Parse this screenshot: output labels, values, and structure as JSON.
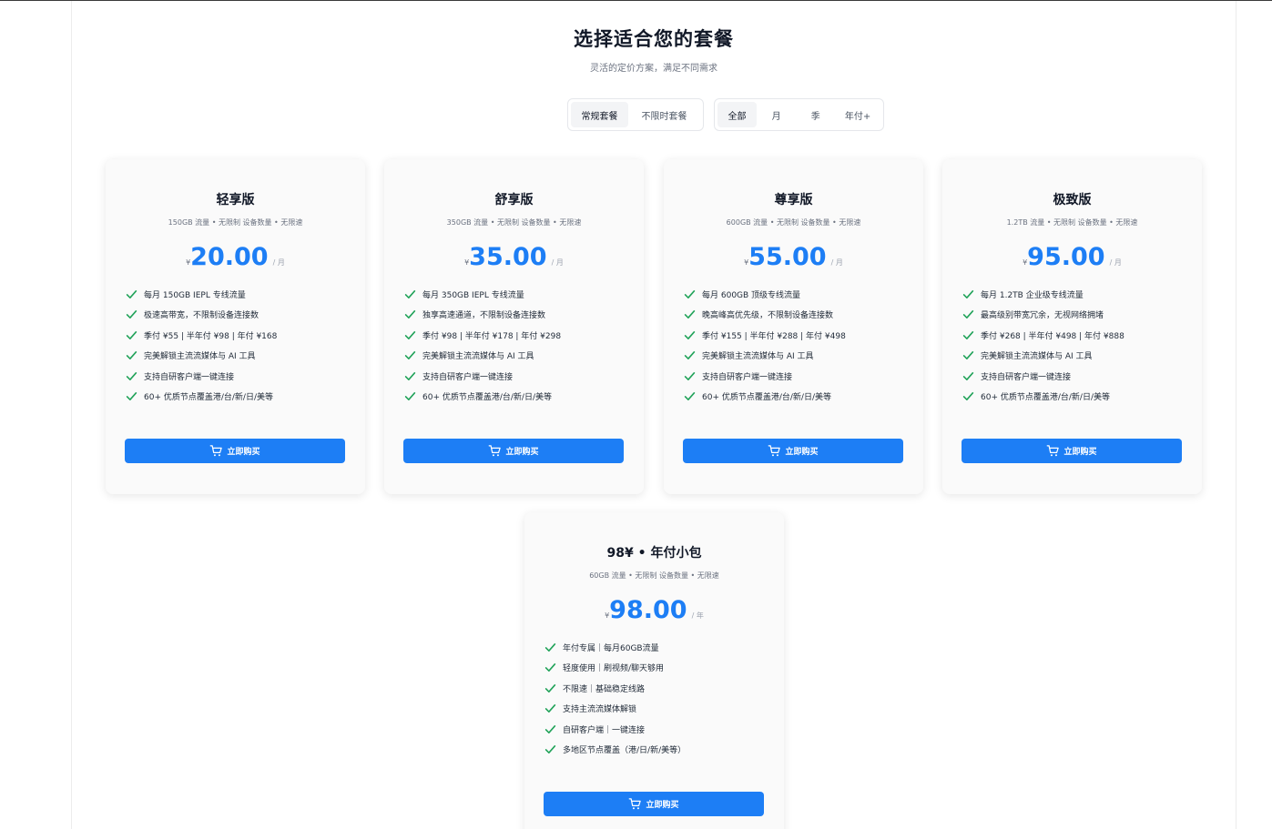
{
  "header": {
    "title": "选择适合您的套餐",
    "subtitle": "灵活的定价方案，满足不同需求"
  },
  "plan_type_tabs": [
    {
      "label": "常规套餐",
      "active": true
    },
    {
      "label": "不限时套餐",
      "active": false
    }
  ],
  "period_tabs": [
    {
      "label": "全部",
      "active": true
    },
    {
      "label": "月",
      "active": false
    },
    {
      "label": "季",
      "active": false
    },
    {
      "label": "年付+",
      "active": false
    }
  ],
  "colors": {
    "accent": "#1d7ef5",
    "check": "#22a35a"
  },
  "plans": [
    {
      "name": "轻享版",
      "tagline": "150GB 流量 • 无限制 设备数量 • 无限速",
      "currency": "¥",
      "price": "20.00",
      "unit": "/ 月",
      "features": [
        "每月 150GB IEPL 专线流量",
        "极速高带宽，不限制设备连接数",
        "季付 ¥55 | 半年付 ¥98 | 年付 ¥168",
        "完美解锁主流流媒体与 AI 工具",
        "支持自研客户端一键连接",
        "60+ 优质节点覆盖港/台/新/日/美等"
      ],
      "button": "立即购买"
    },
    {
      "name": "舒享版",
      "tagline": "350GB 流量 • 无限制 设备数量 • 无限速",
      "currency": "¥",
      "price": "35.00",
      "unit": "/ 月",
      "features": [
        "每月 350GB IEPL 专线流量",
        "独享高速通道，不限制设备连接数",
        "季付 ¥98 | 半年付 ¥178 | 年付 ¥298",
        "完美解锁主流流媒体与 AI 工具",
        "支持自研客户端一键连接",
        "60+ 优质节点覆盖港/台/新/日/美等"
      ],
      "button": "立即购买"
    },
    {
      "name": "尊享版",
      "tagline": "600GB 流量 • 无限制 设备数量 • 无限速",
      "currency": "¥",
      "price": "55.00",
      "unit": "/ 月",
      "features": [
        "每月 600GB 顶级专线流量",
        "晚高峰高优先级，不限制设备连接数",
        "季付 ¥155 | 半年付 ¥288 | 年付 ¥498",
        "完美解锁主流流媒体与 AI 工具",
        "支持自研客户端一键连接",
        "60+ 优质节点覆盖港/台/新/日/美等"
      ],
      "button": "立即购买"
    },
    {
      "name": "极致版",
      "tagline": "1.2TB 流量 • 无限制 设备数量 • 无限速",
      "currency": "¥",
      "price": "95.00",
      "unit": "/ 月",
      "features": [
        "每月 1.2TB 企业级专线流量",
        "最高级别带宽冗余，无视网络拥堵",
        "季付 ¥268 | 半年付 ¥498 | 年付 ¥888",
        "完美解锁主流流媒体与 AI 工具",
        "支持自研客户端一键连接",
        "60+ 优质节点覆盖港/台/新/日/美等"
      ],
      "button": "立即购买"
    },
    {
      "name": "98¥ • 年付小包",
      "tagline": "60GB 流量 • 无限制 设备数量 • 无限速",
      "currency": "¥",
      "price": "98.00",
      "unit": "/ 年",
      "features": [
        "年付专属｜每月60GB流量",
        "轻度使用｜刷视频/聊天够用",
        "不限速｜基础稳定线路",
        "支持主流流媒体解锁",
        "自研客户端｜一键连接",
        "多地区节点覆盖（港/日/新/美等）"
      ],
      "button": "立即购买"
    }
  ]
}
